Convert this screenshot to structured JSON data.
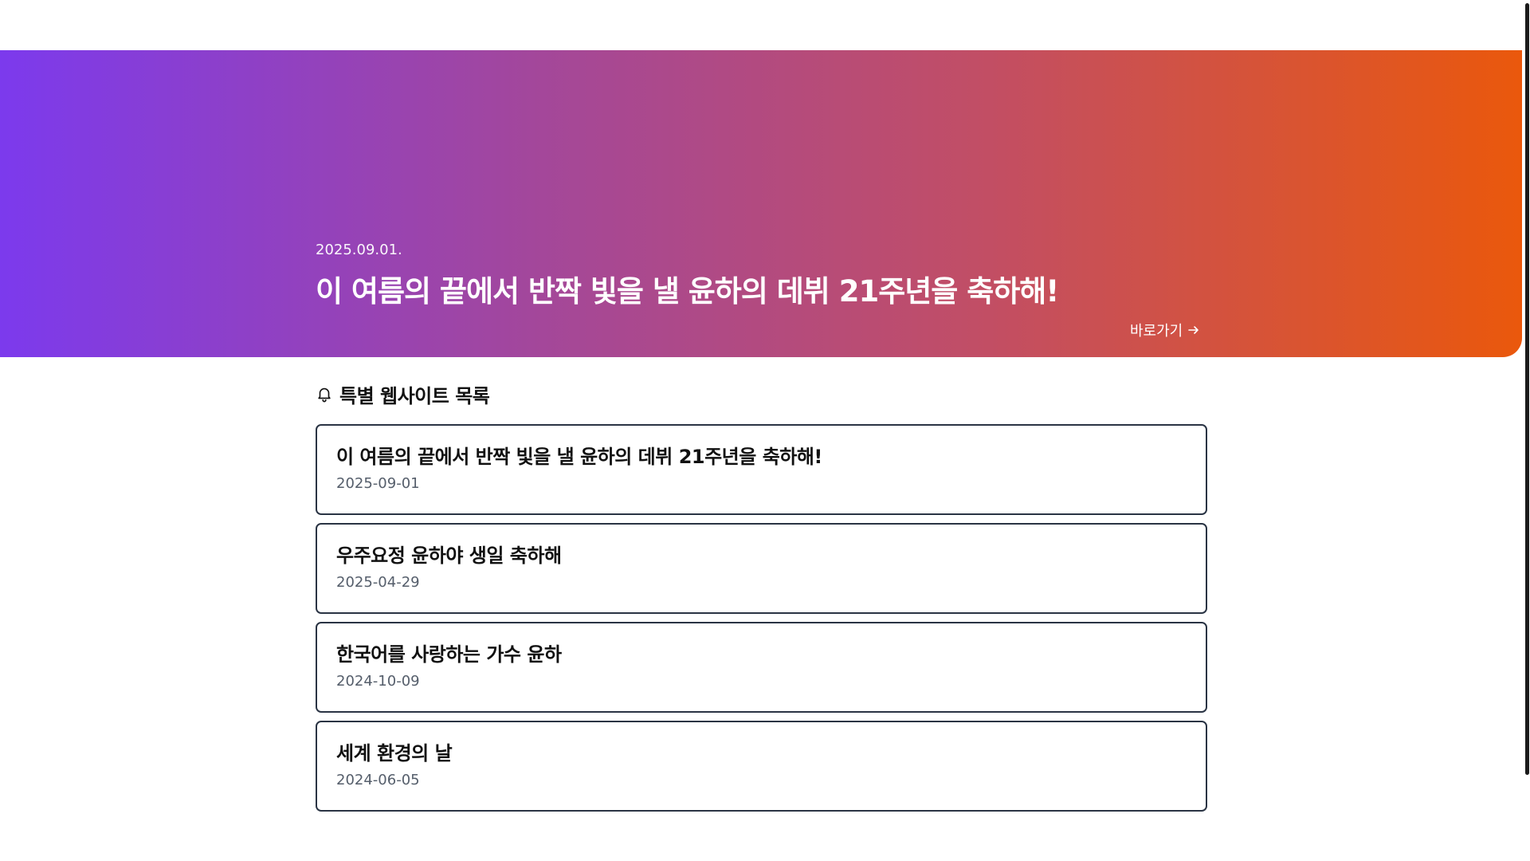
{
  "hero": {
    "date": "2025.09.01.",
    "title": "이 여름의 끝에서 반짝 빛을 낼 윤하의 데뷔 21주년을 축하해!",
    "link_label": "바로가기",
    "gradient_start": "#7c3aed",
    "gradient_end": "#ea580c"
  },
  "section": {
    "icon": "bell-icon",
    "title": "특별 웹사이트 목록"
  },
  "items": [
    {
      "title": "이 여름의 끝에서 반짝 빛을 낼 윤하의 데뷔 21주년을 축하해!",
      "date": "2025-09-01"
    },
    {
      "title": "우주요정 윤하야 생일 축하해",
      "date": "2025-04-29"
    },
    {
      "title": "한국어를 사랑하는 가수 윤하",
      "date": "2024-10-09"
    },
    {
      "title": "세계 환경의 날",
      "date": "2024-06-05"
    }
  ]
}
